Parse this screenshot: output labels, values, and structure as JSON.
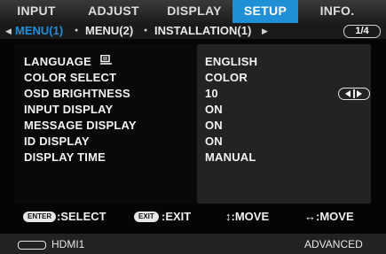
{
  "tabs": [
    {
      "label": "INPUT",
      "active": false
    },
    {
      "label": "ADJUST",
      "active": false
    },
    {
      "label": "DISPLAY",
      "active": false
    },
    {
      "label": "SETUP",
      "active": true
    },
    {
      "label": "INFO.",
      "active": false
    }
  ],
  "submenus": [
    {
      "label": "MENU(1)",
      "active": true
    },
    {
      "label": "MENU(2)",
      "active": false
    },
    {
      "label": "INSTALLATION(1)",
      "active": false
    }
  ],
  "page_indicator": "1/4",
  "settings": [
    {
      "label": "LANGUAGE",
      "value": "ENGLISH",
      "icon": "language-icon"
    },
    {
      "label": "COLOR SELECT",
      "value": "COLOR"
    },
    {
      "label": "OSD BRIGHTNESS",
      "value": "10",
      "control": "left-right-arrows"
    },
    {
      "label": "INPUT DISPLAY",
      "value": "ON"
    },
    {
      "label": "MESSAGE DISPLAY",
      "value": "ON"
    },
    {
      "label": "ID DISPLAY",
      "value": "ON"
    },
    {
      "label": "DISPLAY TIME",
      "value": "MANUAL"
    }
  ],
  "hints": {
    "enter_key": "ENTER",
    "enter_action": ":SELECT",
    "exit_key": "EXIT",
    "exit_action": ":EXIT",
    "move_vertical": "↕:MOVE",
    "move_horizontal": "↔:MOVE"
  },
  "status": {
    "source": "HDMI1",
    "mode": "ADVANCED"
  },
  "colors": {
    "accent": "#1f8fd6",
    "background": "#050505",
    "value_panel": "#232323"
  }
}
